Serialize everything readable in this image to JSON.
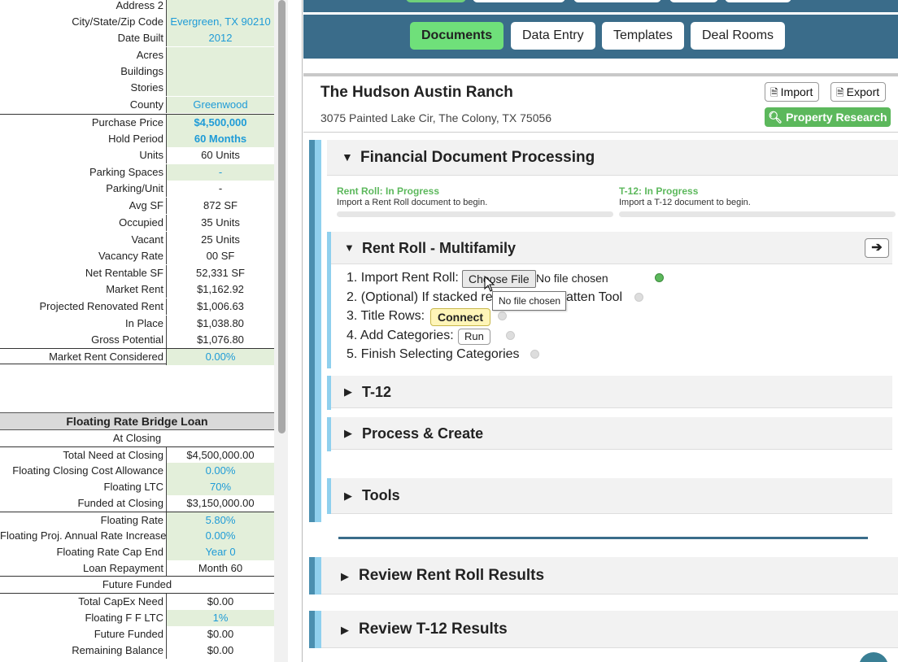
{
  "sheet": {
    "rows1": [
      {
        "label": "Address 2",
        "value": "",
        "green": true
      },
      {
        "label": "City/State/Zip Code",
        "value": "Evergreen, TX 90210",
        "green": true,
        "blue": true
      },
      {
        "label": "Date Built",
        "value": "2012",
        "green": true,
        "blue": true
      },
      {
        "label": "Acres",
        "value": "",
        "green": true
      },
      {
        "label": "Buildings",
        "value": "",
        "green": true
      },
      {
        "label": "Stories",
        "value": "",
        "green": true
      },
      {
        "label": "County",
        "value": "Greenwood",
        "green": true,
        "blue": true
      },
      {
        "label": "Purchase Price",
        "value": "$4,500,000",
        "green": true,
        "bold": true
      },
      {
        "label": "Hold Period",
        "value": "60 Months",
        "green": true,
        "bold": true
      },
      {
        "label": "Units",
        "value": "60 Units"
      },
      {
        "label": "Parking Spaces",
        "value": "-",
        "green": true,
        "blue": true
      },
      {
        "label": "Parking/Unit",
        "value": "-"
      },
      {
        "label": "Avg SF",
        "value": "872 SF"
      },
      {
        "label": "Occupied",
        "value": "35 Units"
      },
      {
        "label": "Vacant",
        "value": "25 Units"
      },
      {
        "label": "Vacancy Rate",
        "value": "00 SF"
      },
      {
        "label": "Net Rentable SF",
        "value": "52,331 SF"
      },
      {
        "label": "Market Rent",
        "value": "$1,162.92"
      },
      {
        "label": "Projected Renovated Rent",
        "value": "$1,006.63"
      },
      {
        "label": "In Place",
        "value": "$1,038.80"
      },
      {
        "label": "Gross Potential",
        "value": "$1,076.80"
      },
      {
        "label": "Market Rent Considered",
        "value": "0.00%",
        "green": true,
        "blue": true
      }
    ],
    "loan_title": "Floating Rate Bridge Loan",
    "at_closing": "At Closing",
    "rows2": [
      {
        "label": "Total Need at Closing",
        "value": "$4,500,000.00"
      },
      {
        "label": "Floating Closing Cost Allowance",
        "value": "0.00%",
        "green": true,
        "blue": true
      },
      {
        "label": "Floating LTC",
        "value": "70%",
        "green": true,
        "blue": true
      },
      {
        "label": "Funded at Closing",
        "value": "$3,150,000.00"
      },
      {
        "label": "Floating Rate",
        "value": "5.80%",
        "green": true,
        "blue": true
      },
      {
        "label": "Floating Proj. Annual Rate Increase",
        "value": "0.00%",
        "green": true,
        "blue": true
      },
      {
        "label": "Floating Rate Cap End",
        "value": "Year 0",
        "green": true,
        "blue": true
      },
      {
        "label": "Loan Repayment",
        "value": "Month 60"
      }
    ],
    "future_funded_header": "Future Funded",
    "rows3": [
      {
        "label": "Total CapEx Need",
        "value": "$0.00"
      },
      {
        "label": "Floating F F LTC",
        "value": "1%",
        "green": true,
        "blue": true
      },
      {
        "label": "Future Funded",
        "value": "$0.00"
      },
      {
        "label": "Remaining Balance",
        "value": "$0.00"
      }
    ]
  },
  "nav": {
    "tabs": [
      "Documents",
      "Data Entry",
      "Templates",
      "Deal Rooms"
    ]
  },
  "property": {
    "title": "The Hudson Austin Ranch",
    "address": "3075 Painted Lake Cir, The Colony, TX 75056",
    "import_label": "Import",
    "export_label": "Export",
    "research_label": "Property Research"
  },
  "fdp": {
    "title": "Financial Document Processing",
    "rent_roll_status": "Rent Roll: In Progress",
    "rent_roll_msg": "Import a Rent Roll document to begin.",
    "t12_status": "T-12: In Progress",
    "t12_msg": "Import a T-12 document to begin."
  },
  "rent_roll": {
    "title": "Rent Roll - Multifamily",
    "step1": "1. Import Rent Roll:",
    "choose_file": "Choose File",
    "no_file": "No file chosen",
    "step2a": "2. (Optional) If stacked re",
    "step2b": "atten Tool",
    "step3": "3. Title Rows:",
    "connect": "Connect",
    "step4": "4. Add Categories:",
    "run": "Run",
    "step5": "5. Finish Selecting Categories",
    "tooltip": "No file chosen"
  },
  "sections": {
    "t12": "T-12",
    "process": "Process & Create",
    "tools": "Tools",
    "review_rr": "Review Rent Roll Results",
    "review_t12": "Review T-12 Results"
  },
  "colors": {
    "accent": "#3a6c8a",
    "green": "#5cb85c",
    "sheet_blue": "#1e9bd7",
    "sheet_green_fill": "#e3efda"
  }
}
